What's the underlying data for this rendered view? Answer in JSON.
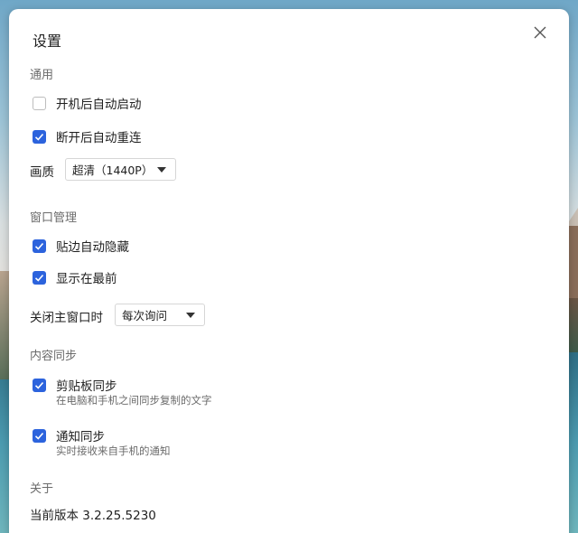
{
  "dialog": {
    "title": "设置"
  },
  "general": {
    "heading": "通用",
    "autostart": {
      "label": "开机后自动启动",
      "checked": false
    },
    "reconnect": {
      "label": "断开后自动重连",
      "checked": true
    },
    "quality": {
      "label": "画质",
      "value": "超清（1440P）"
    }
  },
  "window": {
    "heading": "窗口管理",
    "auto_hide": {
      "label": "贴边自动隐藏",
      "checked": true
    },
    "on_top": {
      "label": "显示在最前",
      "checked": true
    },
    "close_main": {
      "label": "关闭主窗口时",
      "value": "每次询问"
    }
  },
  "sync": {
    "heading": "内容同步",
    "clipboard": {
      "label": "剪贴板同步",
      "desc": "在电脑和手机之间同步复制的文字",
      "checked": true
    },
    "notify": {
      "label": "通知同步",
      "desc": "实时接收来自手机的通知",
      "checked": true
    }
  },
  "about": {
    "heading": "关于",
    "version": "当前版本 3.2.25.5230"
  },
  "colors": {
    "accent": "#2c63dd"
  },
  "icons": {
    "close": "close-icon",
    "check": "checkmark-icon",
    "dropdown": "chevron-down-icon"
  }
}
